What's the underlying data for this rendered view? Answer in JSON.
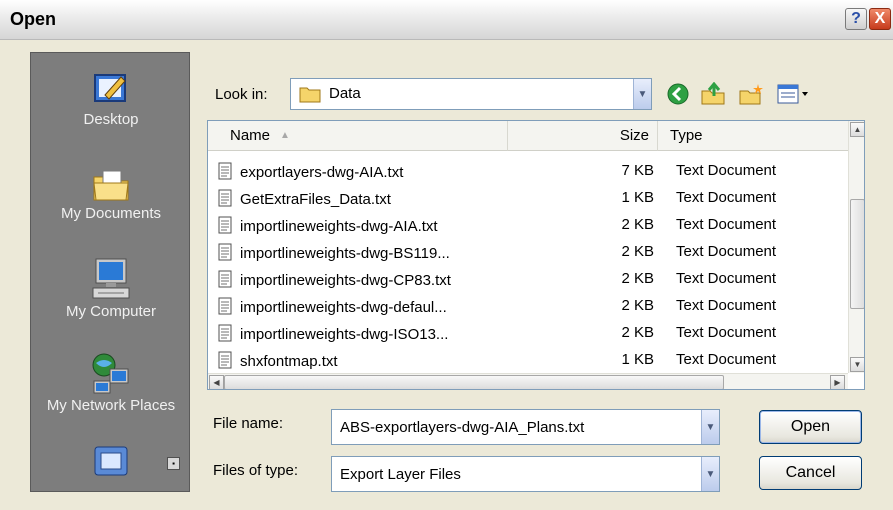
{
  "window": {
    "title": "Open",
    "help_label": "?",
    "close_label": "X"
  },
  "places": [
    {
      "label": "Desktop",
      "icon": "desktop-icon"
    },
    {
      "label": "My Documents",
      "icon": "my-documents-icon"
    },
    {
      "label": "My Computer",
      "icon": "my-computer-icon"
    },
    {
      "label": "My Network Places",
      "icon": "my-network-places-icon"
    }
  ],
  "look_in": {
    "label": "Look in:",
    "value": "Data"
  },
  "toolbar": {
    "icons": [
      "back-icon",
      "up-folder-icon",
      "new-folder-icon",
      "view-menu-icon"
    ]
  },
  "columns": {
    "name": "Name",
    "size": "Size",
    "type": "Type"
  },
  "files": [
    {
      "name": "exportlayers-dwg-AIA.txt",
      "size": "7 KB",
      "type": "Text Document"
    },
    {
      "name": "GetExtraFiles_Data.txt",
      "size": "1 KB",
      "type": "Text Document"
    },
    {
      "name": "importlineweights-dwg-AIA.txt",
      "size": "2 KB",
      "type": "Text Document"
    },
    {
      "name": "importlineweights-dwg-BS119...",
      "size": "2 KB",
      "type": "Text Document"
    },
    {
      "name": "importlineweights-dwg-CP83.txt",
      "size": "2 KB",
      "type": "Text Document"
    },
    {
      "name": "importlineweights-dwg-defaul...",
      "size": "2 KB",
      "type": "Text Document"
    },
    {
      "name": "importlineweights-dwg-ISO13...",
      "size": "2 KB",
      "type": "Text Document"
    },
    {
      "name": "shxfontmap.txt",
      "size": "1 KB",
      "type": "Text Document"
    }
  ],
  "file_name": {
    "label": "File name:",
    "value": "ABS-exportlayers-dwg-AIA_Plans.txt"
  },
  "file_type": {
    "label": "Files of type:",
    "value": "Export Layer Files"
  },
  "buttons": {
    "open": "Open",
    "cancel": "Cancel"
  }
}
